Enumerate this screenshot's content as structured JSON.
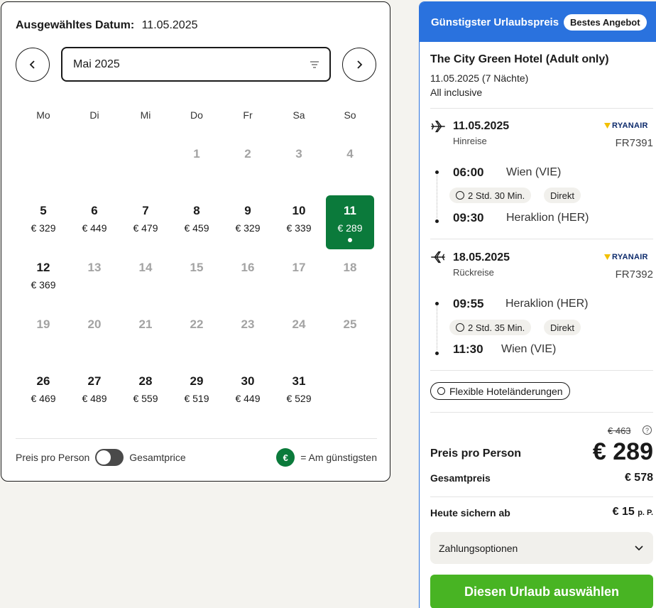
{
  "calendar": {
    "selected_label": "Ausgewähltes Datum:",
    "selected_value": "11.05.2025",
    "month": "Mai 2025",
    "weekdays": [
      "Mo",
      "Di",
      "Mi",
      "Do",
      "Fr",
      "Sa",
      "So"
    ],
    "days": [
      {
        "day": "1",
        "price": "",
        "disabled": true
      },
      {
        "day": "2",
        "price": "",
        "disabled": true
      },
      {
        "day": "3",
        "price": "",
        "disabled": true
      },
      {
        "day": "4",
        "price": "",
        "disabled": true
      },
      {
        "day": "5",
        "price": "€ 329",
        "disabled": false
      },
      {
        "day": "6",
        "price": "€ 449",
        "disabled": false
      },
      {
        "day": "7",
        "price": "€ 479",
        "disabled": false
      },
      {
        "day": "8",
        "price": "€ 459",
        "disabled": false
      },
      {
        "day": "9",
        "price": "€ 329",
        "disabled": false
      },
      {
        "day": "10",
        "price": "€ 339",
        "disabled": false
      },
      {
        "day": "11",
        "price": "€ 289",
        "disabled": false,
        "selected": true
      },
      {
        "day": "12",
        "price": "€ 369",
        "disabled": false
      },
      {
        "day": "13",
        "price": "",
        "disabled": true
      },
      {
        "day": "14",
        "price": "",
        "disabled": true
      },
      {
        "day": "15",
        "price": "",
        "disabled": true
      },
      {
        "day": "16",
        "price": "",
        "disabled": true
      },
      {
        "day": "17",
        "price": "",
        "disabled": true
      },
      {
        "day": "18",
        "price": "",
        "disabled": true
      },
      {
        "day": "19",
        "price": "",
        "disabled": true
      },
      {
        "day": "20",
        "price": "",
        "disabled": true
      },
      {
        "day": "21",
        "price": "",
        "disabled": true
      },
      {
        "day": "22",
        "price": "",
        "disabled": true
      },
      {
        "day": "23",
        "price": "",
        "disabled": true
      },
      {
        "day": "24",
        "price": "",
        "disabled": true
      },
      {
        "day": "25",
        "price": "",
        "disabled": true
      },
      {
        "day": "26",
        "price": "€ 469",
        "disabled": false
      },
      {
        "day": "27",
        "price": "€ 489",
        "disabled": false
      },
      {
        "day": "28",
        "price": "€ 559",
        "disabled": false
      },
      {
        "day": "29",
        "price": "€ 519",
        "disabled": false
      },
      {
        "day": "30",
        "price": "€ 449",
        "disabled": false
      },
      {
        "day": "31",
        "price": "€ 529",
        "disabled": false
      }
    ],
    "footer": {
      "per_person": "Preis pro Person",
      "total": "Gesamtprice",
      "legend_symbol": "€",
      "legend_text": "= Am günstigsten"
    }
  },
  "offer": {
    "header": "Günstigster Urlaubspreis",
    "badge": "Bestes Angebot",
    "hotel": "The City Green Hotel (Adult only)",
    "dates": "11.05.2025 (7 Nächte)",
    "board": "All inclusive",
    "outbound": {
      "date": "11.05.2025",
      "direction": "Hinreise",
      "airline": "RYANAIR",
      "code": "FR7391",
      "dep_time": "06:00",
      "dep_place": "Wien (VIE)",
      "duration": "2 Std. 30 Min.",
      "type": "Direkt",
      "arr_time": "09:30",
      "arr_place": "Heraklion (HER)"
    },
    "return": {
      "date": "18.05.2025",
      "direction": "Rückreise",
      "airline": "RYANAIR",
      "code": "FR7392",
      "dep_time": "09:55",
      "dep_place": "Heraklion (HER)",
      "duration": "2 Std. 35 Min.",
      "type": "Direkt",
      "arr_time": "11:30",
      "arr_place": "Wien (VIE)"
    },
    "flexible": "Flexible Hoteländerungen",
    "old_price": "€ 463",
    "help_symbol": "?",
    "per_person_label": "Preis pro Person",
    "per_person_price": "€ 289",
    "total_label": "Gesamtpreis",
    "total_price": "€ 578",
    "secure_label": "Heute sichern ab",
    "secure_price": "€ 15",
    "secure_unit": "p. P.",
    "payment": "Zahlungsoptionen",
    "cta": "Diesen Urlaub auswählen"
  },
  "colors": {
    "selected_day": "#0b7a3b",
    "header_blue": "#2a72de",
    "cta_green": "#48b423"
  }
}
